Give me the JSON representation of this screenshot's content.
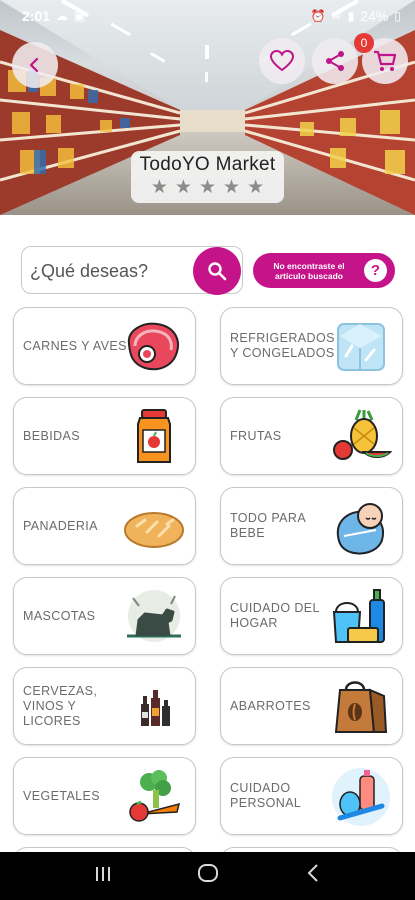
{
  "status_bar": {
    "time": "2:01",
    "battery": "24%"
  },
  "header": {
    "back_icon": "chevron-left-icon",
    "store_name": "TodoYO Market",
    "rating_stars": 5,
    "cart_count": "0",
    "brand_color": "#c5148a"
  },
  "search": {
    "placeholder": "¿Qué deseas?",
    "not_found_label": "No encontraste el artículo buscado",
    "help_glyph": "?"
  },
  "categories": [
    {
      "label": "CARNES Y AVES",
      "icon": "meat-icon"
    },
    {
      "label": "REFRIGERADOS Y CONGELADOS",
      "icon": "ice-cube-icon"
    },
    {
      "label": "BEBIDAS",
      "icon": "juice-jar-icon"
    },
    {
      "label": "FRUTAS",
      "icon": "fruits-icon"
    },
    {
      "label": "PANADERIA",
      "icon": "bread-icon"
    },
    {
      "label": "TODO PARA BEBE",
      "icon": "baby-icon"
    },
    {
      "label": "MASCOTAS",
      "icon": "pet-dog-icon"
    },
    {
      "label": "CUIDADO DEL HOGAR",
      "icon": "cleaning-supplies-icon"
    },
    {
      "label": "CERVEZAS, VINOS Y LICORES",
      "icon": "bottles-icon"
    },
    {
      "label": "ABARROTES",
      "icon": "grocery-bag-icon"
    },
    {
      "label": "VEGETALES",
      "icon": "vegetables-icon"
    },
    {
      "label": "CUIDADO PERSONAL",
      "icon": "personal-care-icon"
    }
  ],
  "nav": {
    "recents": "recents-icon",
    "home": "home-icon",
    "back": "back-icon"
  }
}
